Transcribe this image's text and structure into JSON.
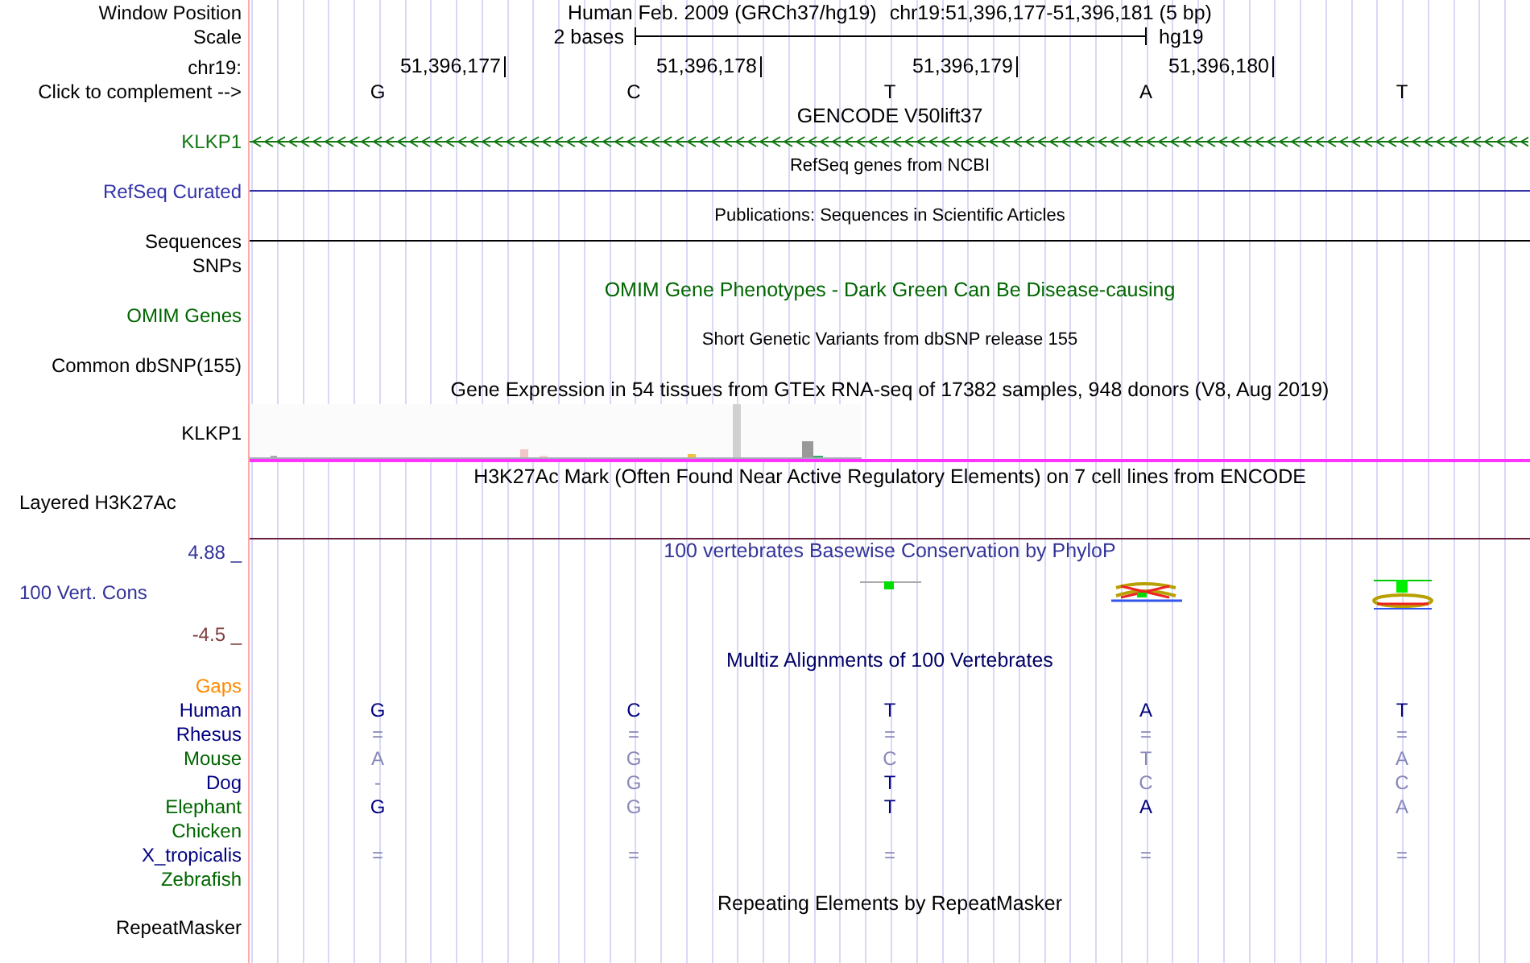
{
  "header": {
    "window_position": {
      "label": "Window Position",
      "assembly": "Human Feb. 2009 (GRCh37/hg19)",
      "range": "chr19:51,396,177-51,396,181 (5 bp)"
    },
    "scale": {
      "label": "Scale",
      "text": "2 bases",
      "assembly": "hg19"
    },
    "ruler": {
      "label": "chr19:",
      "positions": [
        "51,396,177",
        "51,396,178",
        "51,396,179",
        "51,396,180"
      ]
    },
    "complement": {
      "label": "Click to complement -->",
      "bases": [
        "G",
        "C",
        "T",
        "A",
        "T"
      ]
    }
  },
  "tracks": [
    {
      "kind": "title",
      "text": "GENCODE V50lift37"
    },
    {
      "kind": "gene",
      "label": "KLKP1",
      "color": "#117711"
    },
    {
      "kind": "small_title",
      "text": "RefSeq genes from NCBI"
    },
    {
      "kind": "line",
      "label": "RefSeq Curated",
      "color": "#3333aa"
    },
    {
      "kind": "small_title",
      "text": "Publications: Sequences in Scientific Articles"
    },
    {
      "kind": "line",
      "label": "Sequences",
      "color": "#000000"
    },
    {
      "kind": "empty",
      "label": "SNPs"
    },
    {
      "kind": "title",
      "text": "OMIM Gene Phenotypes - Dark Green Can Be Disease-causing",
      "color": "#006600"
    },
    {
      "kind": "empty",
      "label": "OMIM Genes",
      "color": "#006600"
    },
    {
      "kind": "small_title",
      "text": "Short Genetic Variants from dbSNP release 155"
    },
    {
      "kind": "empty",
      "label": "Common dbSNP(155)"
    },
    {
      "kind": "title",
      "text": "Gene Expression in 54 tissues from GTEx RNA-seq of 17382 samples, 948 donors (V8, Aug 2019)"
    },
    {
      "kind": "expression",
      "label": "KLKP1"
    },
    {
      "kind": "title",
      "text": "H3K27Ac Mark (Often Found Near Active Regulatory Elements) on 7 cell lines from ENCODE"
    },
    {
      "kind": "signal",
      "label": "Layered H3K27Ac"
    },
    {
      "kind": "conservation",
      "label": "100 Vert. Cons",
      "color": "#333399",
      "title": "100 vertebrates Basewise Conservation by PhyloP",
      "max": "4.88 _",
      "min": "-4.5 _"
    },
    {
      "kind": "title",
      "text": "Multiz Alignments of 100 Vertebrates",
      "color": "#000066"
    },
    {
      "kind": "empty",
      "label": "Gaps",
      "color": "#ff8800"
    },
    {
      "kind": "bases",
      "label": "Human",
      "color": "#000080",
      "bases": [
        {
          "text": "G",
          "faint": false
        },
        {
          "text": "C",
          "faint": false
        },
        {
          "text": "T",
          "faint": false
        },
        {
          "text": "A",
          "faint": false
        },
        {
          "text": "T",
          "faint": false
        }
      ]
    },
    {
      "kind": "bases",
      "label": "Rhesus",
      "color": "#000080",
      "bases": [
        {
          "text": "=",
          "faint": true
        },
        {
          "text": "=",
          "faint": true
        },
        {
          "text": "=",
          "faint": true
        },
        {
          "text": "=",
          "faint": true
        },
        {
          "text": "=",
          "faint": true
        }
      ]
    },
    {
      "kind": "bases",
      "label": "Mouse",
      "color": "#006600",
      "bases": [
        {
          "text": "A",
          "faint": true
        },
        {
          "text": "G",
          "faint": true
        },
        {
          "text": "C",
          "faint": true
        },
        {
          "text": "T",
          "faint": true
        },
        {
          "text": "A",
          "faint": true
        }
      ]
    },
    {
      "kind": "bases",
      "label": "Dog",
      "color": "#000080",
      "bases": [
        {
          "text": "-",
          "faint": true
        },
        {
          "text": "G",
          "faint": true
        },
        {
          "text": "T",
          "faint": false
        },
        {
          "text": "C",
          "faint": true
        },
        {
          "text": "C",
          "faint": true
        }
      ]
    },
    {
      "kind": "bases",
      "label": "Elephant",
      "color": "#006600",
      "bases": [
        {
          "text": "G",
          "faint": false
        },
        {
          "text": "G",
          "faint": true
        },
        {
          "text": "T",
          "faint": false
        },
        {
          "text": "A",
          "faint": false
        },
        {
          "text": "A",
          "faint": true
        }
      ]
    },
    {
      "kind": "empty",
      "label": "Chicken",
      "color": "#006600"
    },
    {
      "kind": "bases",
      "label": "X_tropicalis",
      "color": "#000080",
      "bases": [
        {
          "text": "=",
          "faint": true
        },
        {
          "text": "=",
          "faint": true
        },
        {
          "text": "=",
          "faint": true
        },
        {
          "text": "=",
          "faint": true
        },
        {
          "text": "=",
          "faint": true
        }
      ]
    },
    {
      "kind": "empty",
      "label": "Zebrafish",
      "color": "#006600"
    },
    {
      "kind": "title",
      "text": "Repeating Elements by RepeatMasker"
    },
    {
      "kind": "bottom",
      "label": "RepeatMasker"
    }
  ]
}
